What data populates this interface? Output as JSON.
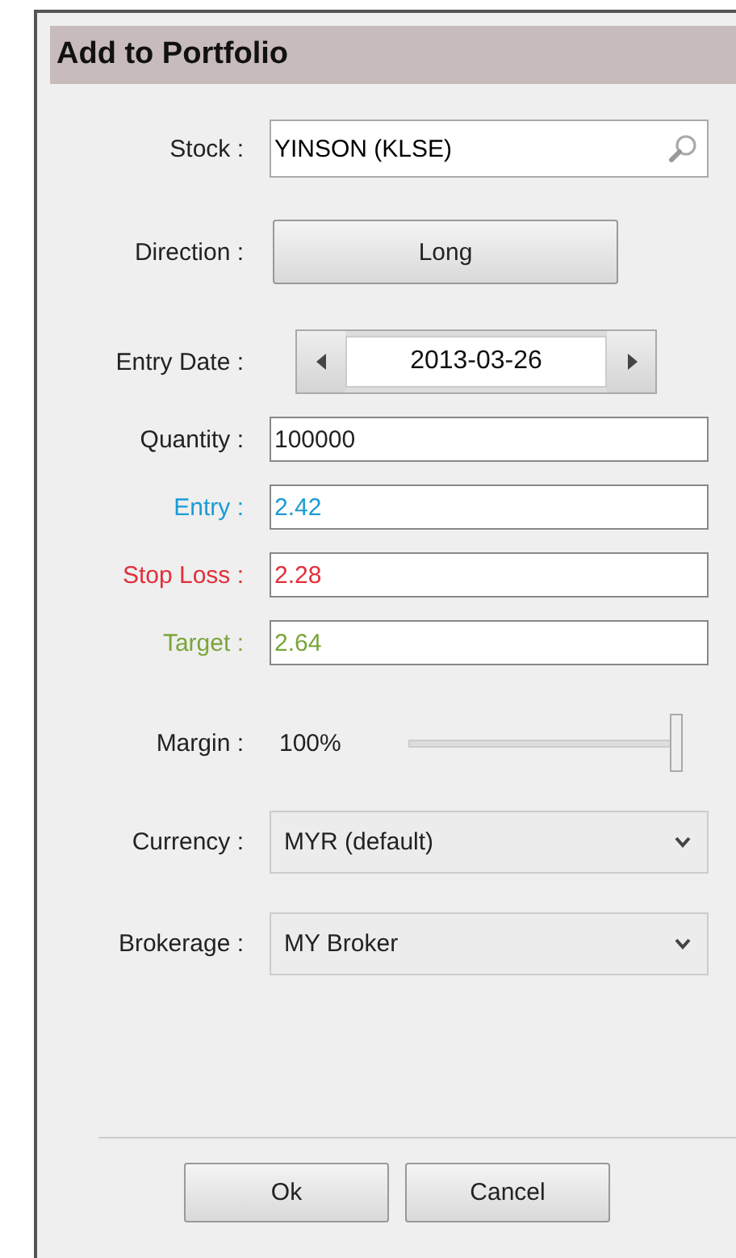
{
  "dialog": {
    "title": "Add to Portfolio"
  },
  "fields": [
    {
      "kind": "search",
      "label": "Stock :",
      "value": "YINSON (KLSE)"
    },
    {
      "kind": "toggle",
      "label": "Direction :",
      "value": "Long"
    },
    {
      "kind": "date",
      "label": "Entry Date :",
      "value": "2013-03-26"
    },
    {
      "kind": "text",
      "label": "Quantity :",
      "value": "100000"
    },
    {
      "kind": "text",
      "label": "Entry :",
      "value": "2.42",
      "color": "#1a9bd7"
    },
    {
      "kind": "text",
      "label": "Stop Loss :",
      "value": "2.28",
      "color": "#e0303a"
    },
    {
      "kind": "text",
      "label": "Target :",
      "value": "2.64",
      "color": "#7aa53a"
    },
    {
      "kind": "slider",
      "label": "Margin :",
      "value": "100%",
      "level": 1
    },
    {
      "kind": "select",
      "label": "Currency :",
      "value": "MYR (default)"
    },
    {
      "kind": "select",
      "label": "Brokerage :",
      "value": "MY Broker"
    }
  ],
  "buttons": [
    "Ok",
    "Cancel"
  ]
}
